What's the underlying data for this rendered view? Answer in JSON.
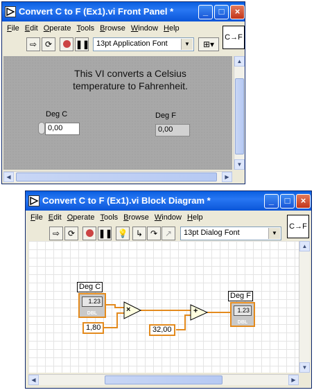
{
  "front_panel": {
    "title": "Convert C to F (Ex1).vi Front Panel *",
    "menu": [
      "File",
      "Edit",
      "Operate",
      "Tools",
      "Browse",
      "Window",
      "Help"
    ],
    "font_selector": "13pt Application Font",
    "icon_label": "C→F",
    "description": "This VI converts a Celsius temperature to Fahrenheit.",
    "control_label": "Deg C",
    "control_value": "0,00",
    "indicator_label": "Deg F",
    "indicator_value": "0,00"
  },
  "block_diagram": {
    "title": "Convert C to F (Ex1).vi Block Diagram *",
    "menu": [
      "File",
      "Edit",
      "Operate",
      "Tools",
      "Browse",
      "Window",
      "Help"
    ],
    "font_selector": "13pt Dialog Font",
    "icon_label": "C→F",
    "terminal_in_label": "Deg C",
    "terminal_out_label": "Deg F",
    "terminal_value_text": "1.23",
    "terminal_type": "DBL",
    "constant_1": "1,80",
    "constant_2": "32,00",
    "multiply_symbol": "×",
    "add_symbol": "+"
  },
  "colors": {
    "titlebar": "#2161e8",
    "wire_orange": "#e38a1d",
    "panel_gray": "#a8a8a8"
  },
  "icons": [
    "run-arrow-icon",
    "run-continuous-icon",
    "abort-icon",
    "pause-icon",
    "highlight-execution-icon",
    "step-into-icon",
    "step-over-icon",
    "step-out-icon",
    "text-align-icon"
  ]
}
